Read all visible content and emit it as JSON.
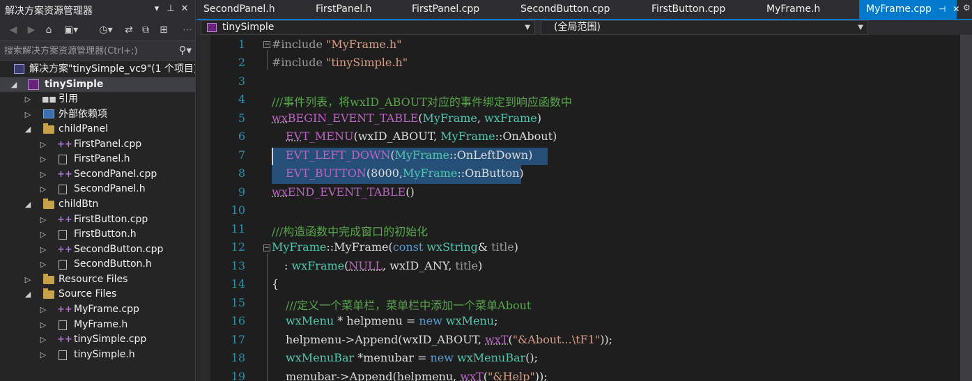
{
  "explorer": {
    "title": "解决方案资源管理器",
    "title_btn_dropdown": "▾",
    "title_btn_pin": "📌",
    "title_btn_close": "✕",
    "toolbar": [
      "back-icon",
      "forward-icon",
      "home-icon",
      "switch-views-icon",
      "history-icon",
      "sync-icon",
      "collapse-all-icon",
      "properties-icon"
    ],
    "search_placeholder": "搜索解决方案资源管理器(Ctrl+;)",
    "tree": [
      {
        "label": "解决方案\"tinySimple_vc9\"(1 个项目)",
        "icon": "solution-icon"
      },
      {
        "label": "tinySimple",
        "icon": "project-icon"
      },
      {
        "label": "引用",
        "icon": "references-icon"
      },
      {
        "label": "外部依赖项",
        "icon": "external-deps-icon"
      },
      {
        "label": "childPanel",
        "icon": "filter-folder-icon"
      },
      {
        "label": "FirstPanel.cpp",
        "icon": "cpp-file-icon"
      },
      {
        "label": "FirstPanel.h",
        "icon": "header-file-icon"
      },
      {
        "label": "SecondPanel.cpp",
        "icon": "cpp-file-icon"
      },
      {
        "label": "SecondPanel.h",
        "icon": "header-file-icon"
      },
      {
        "label": "childBtn",
        "icon": "filter-folder-icon"
      },
      {
        "label": "FirstButton.cpp",
        "icon": "cpp-file-icon"
      },
      {
        "label": "FirstButton.h",
        "icon": "header-file-icon"
      },
      {
        "label": "SecondButton.cpp",
        "icon": "cpp-file-icon"
      },
      {
        "label": "SecondButton.h",
        "icon": "header-file-icon"
      },
      {
        "label": "Resource Files",
        "icon": "filter-folder-icon"
      },
      {
        "label": "Source Files",
        "icon": "filter-folder-icon"
      },
      {
        "label": "MyFrame.cpp",
        "icon": "cpp-file-icon"
      },
      {
        "label": "MyFrame.h",
        "icon": "header-file-icon"
      },
      {
        "label": "tinySimple.cpp",
        "icon": "cpp-file-icon"
      },
      {
        "label": "tinySimple.h",
        "icon": "header-file-icon"
      }
    ]
  },
  "tabs": [
    {
      "label": "SecondPanel.h"
    },
    {
      "label": "FirstPanel.h"
    },
    {
      "label": "FirstPanel.cpp"
    },
    {
      "label": "SecondButton.cpp"
    },
    {
      "label": "FirstButton.cpp"
    },
    {
      "label": "MyFrame.h"
    },
    {
      "label": "MyFrame.cpp",
      "active": true
    }
  ],
  "nav": {
    "project": "tinySimple",
    "scope": "(全局范围)"
  },
  "editor": {
    "line_numbers": [
      "1",
      "2",
      "3",
      "4",
      "5",
      "6",
      "7",
      "8",
      "9",
      "10",
      "11",
      "12",
      "13",
      "14",
      "15",
      "16",
      "17",
      "18",
      "19"
    ],
    "code": {
      "l1_pp": "#include ",
      "l1_str": "\"MyFrame.h\"",
      "l2_pp": "#include ",
      "l2_str": "\"tinySimple.h\"",
      "l4_comment": "///事件列表，将wxID_ABOUT对应的事件绑定到响应函数中",
      "l5_a": "wx",
      "l5_b": "BEGIN_EVENT_TABLE",
      "l5_c": "(",
      "l5_d": "MyFrame",
      "l5_e": ", ",
      "l5_f": "wxFrame",
      "l5_g": ")",
      "l6_a": "EV",
      "l6_b": "T_MENU",
      "l6_c": "(wxID_ABOUT, ",
      "l6_d": "MyFrame",
      "l6_e": "::OnAbout)",
      "l7_a": "EVT_LEFT_DOWN",
      "l7_b": "(",
      "l7_c": "MyFrame",
      "l7_d": "::OnLeftDown)",
      "l8_a": "EVT_BUTTON",
      "l8_b": "(8000,",
      "l8_c": "MyFrame",
      "l8_d": "::OnButton)",
      "l9_a": "wx",
      "l9_b": "END_EVENT_TABLE",
      "l9_c": "()",
      "l11_comment": "///构造函数中完成窗口的初始化",
      "l12_a": "MyFrame",
      "l12_b": "::MyFrame(",
      "l12_c": "const ",
      "l12_d": "wxString",
      "l12_e": "& ",
      "l12_f": "title",
      "l12_g": ")",
      "l13_a": ": ",
      "l13_b": "wxFrame",
      "l13_c": "(",
      "l13_d": "NULL",
      "l13_e": ", wxID_ANY, ",
      "l13_f": "title",
      "l13_g": ")",
      "l14": "{",
      "l15_comment": "///定义一个菜单栏，菜单栏中添加一个菜单About",
      "l16_a": "wxMenu",
      "l16_b": " * helpmenu = ",
      "l16_c": "new ",
      "l16_d": "wxMenu",
      "l16_e": ";",
      "l17_a": "helpmenu->Append(wxID_ABOUT, ",
      "l17_b": "wxT",
      "l17_c": "(",
      "l17_d": "\"&About...\\tF1\"",
      "l17_e": "));",
      "l18_a": "wxMenuBar",
      "l18_b": " *menubar = ",
      "l18_c": "new ",
      "l18_d": "wxMenuBar",
      "l18_e": "();",
      "l19_a": "menubar->Append(helpmenu, ",
      "l19_b": "wxT",
      "l19_c": "(",
      "l19_d": "\"&Help\"",
      "l19_e": "));"
    }
  },
  "colors": {
    "accent": "#007acc",
    "keyword": "#569cd6",
    "type": "#4ec9b0",
    "macro": "#bd63c5",
    "string": "#d69d85",
    "comment": "#57a64a",
    "line_number": "#2b91af",
    "selection": "#264f78"
  }
}
